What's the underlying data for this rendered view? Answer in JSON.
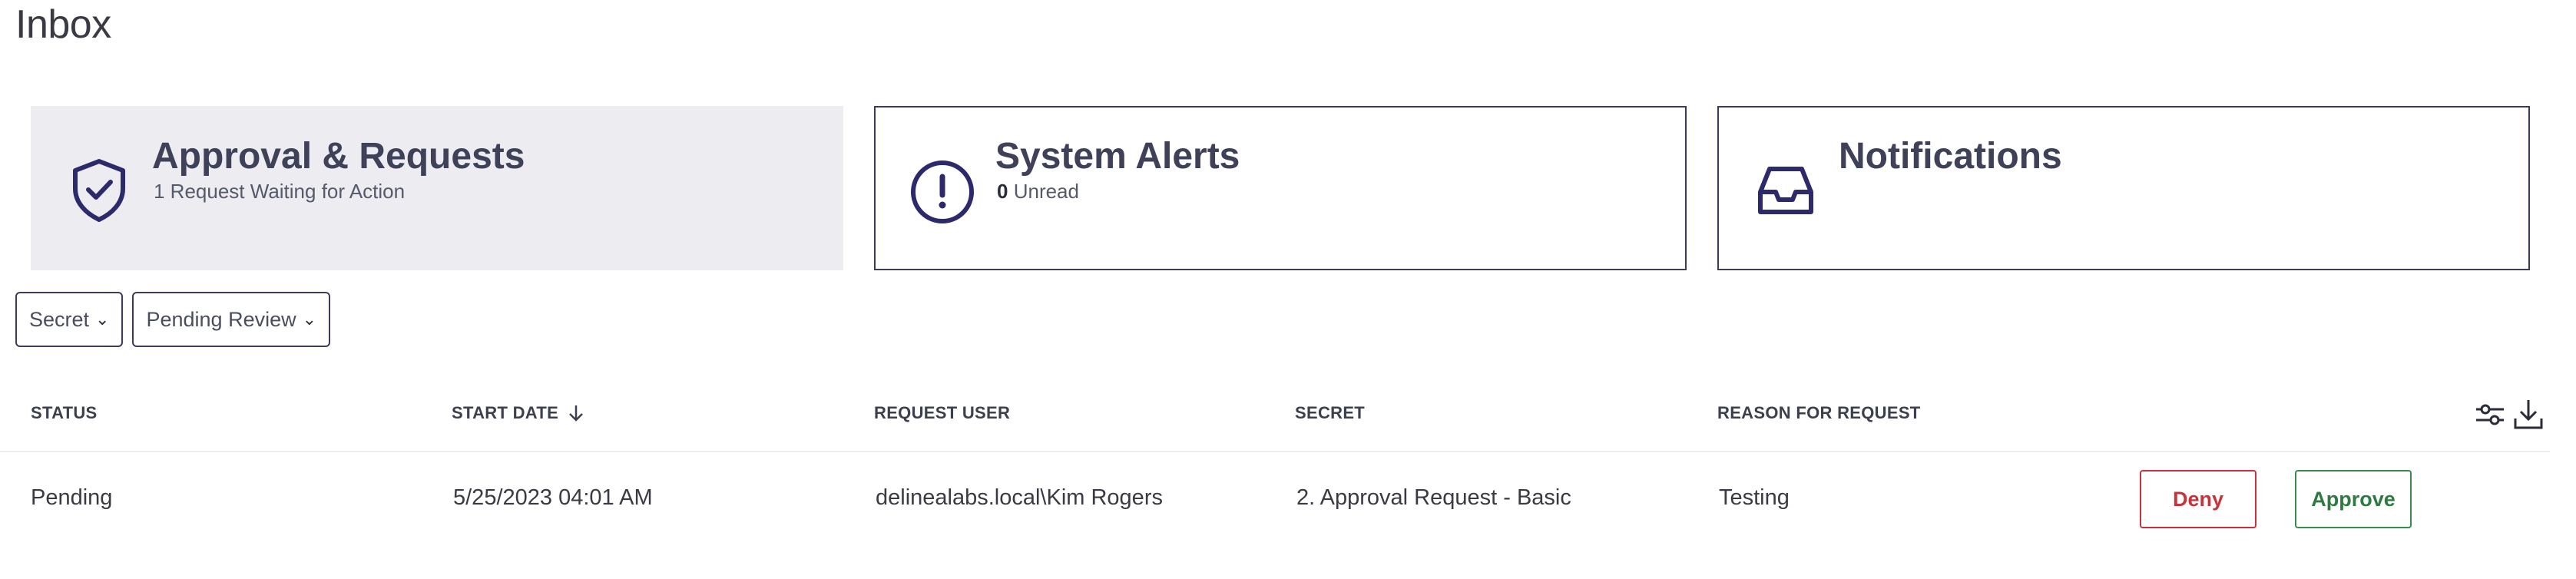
{
  "page": {
    "title": "Inbox"
  },
  "cards": [
    {
      "title": "Approval & Requests",
      "subtitle": "1 Request Waiting for Action",
      "icon": "shield-check-icon"
    },
    {
      "title": "System Alerts",
      "count": "0",
      "subtitle": "Unread",
      "icon": "alert-circle-icon"
    },
    {
      "title": "Notifications",
      "icon": "inbox-tray-icon"
    }
  ],
  "filters": {
    "type": "Secret",
    "status": "Pending Review"
  },
  "table": {
    "columns": [
      "STATUS",
      "START DATE",
      "REQUEST USER",
      "SECRET",
      "REASON FOR REQUEST"
    ],
    "rows": [
      {
        "status": "Pending",
        "start_date": "5/25/2023 04:01 AM",
        "request_user": "delinealabs.local\\Kim Rogers",
        "secret": "2. Approval Request - Basic",
        "reason": "Testing",
        "deny_label": "Deny",
        "approve_label": "Approve"
      }
    ]
  },
  "colors": {
    "accent": "#2d2a6b",
    "active_card_bg": "#ececf1",
    "deny": "#c8323a",
    "approve": "#2e7a40"
  }
}
